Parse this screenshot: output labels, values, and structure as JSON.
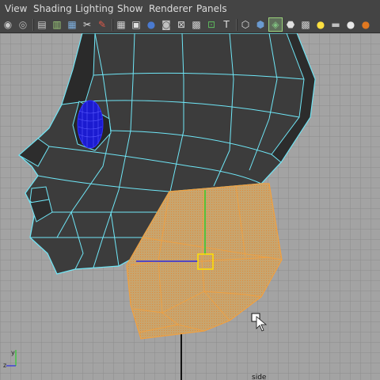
{
  "menu": {
    "items": [
      "View",
      "Shading",
      "Lighting",
      "Show",
      "Renderer",
      "Panels"
    ]
  },
  "toolbar": {
    "buttons": [
      {
        "name": "select-camera-icon",
        "glyph": "◉"
      },
      {
        "name": "lock-camera-icon",
        "glyph": "◎"
      },
      {
        "name": "camera-attributes-icon",
        "glyph": "▤"
      },
      {
        "name": "bookmark-icon",
        "glyph": "▥"
      },
      {
        "name": "image-plane-icon",
        "glyph": "▦"
      },
      {
        "name": "two-d-pan-zoom-icon",
        "glyph": "✂"
      },
      {
        "name": "grease-pencil-icon",
        "glyph": "✎"
      },
      {
        "name": "grid-icon",
        "glyph": "▦"
      },
      {
        "name": "film-gate-icon",
        "glyph": "▣"
      },
      {
        "name": "resolution-gate-icon",
        "glyph": "●"
      },
      {
        "name": "gate-mask-icon",
        "glyph": "◙"
      },
      {
        "name": "field-chart-icon",
        "glyph": "⊠"
      },
      {
        "name": "safe-action-icon",
        "glyph": "▩"
      },
      {
        "name": "safe-title-icon",
        "glyph": "⊡"
      },
      {
        "name": "isolate-select-icon",
        "glyph": "T"
      },
      {
        "name": "wireframe-icon",
        "glyph": "⬡"
      },
      {
        "name": "smooth-shade-icon",
        "glyph": "⬢"
      },
      {
        "name": "wireframe-on-shaded-icon",
        "glyph": "◈"
      },
      {
        "name": "default-material-icon",
        "glyph": "⬣"
      },
      {
        "name": "textured-icon",
        "glyph": "▩"
      },
      {
        "name": "use-all-lights-icon",
        "glyph": "●"
      },
      {
        "name": "shadows-icon",
        "glyph": "▬"
      },
      {
        "name": "ambient-occlusion-icon",
        "glyph": "●"
      },
      {
        "name": "motion-blur-icon",
        "glyph": "●"
      }
    ]
  },
  "viewport": {
    "camera_label": "side",
    "axis_x_label": "z",
    "axis_y_label": "y"
  },
  "colors": {
    "grid_background": "#a3a3a3",
    "grid_line": "#8d8d8d",
    "wire_unselected": "#6fe6f6",
    "wire_selected": "#f0a040",
    "mesh_shaded": "#3c3c3c",
    "selected_face": "#c8a56e",
    "manip_y": "#2ecc2e",
    "manip_z": "#2a2ae0",
    "manip_center": "#ffe000",
    "ui_bg": "#444444"
  }
}
